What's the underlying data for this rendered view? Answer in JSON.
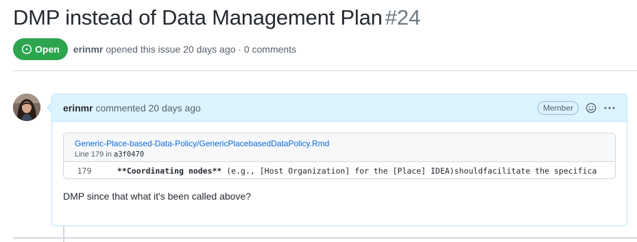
{
  "issue": {
    "title": "DMP instead of Data Management Plan",
    "number": "#24",
    "state": "Open",
    "author": "erinmr",
    "opened_text": "opened this issue 20 days ago · 0 comments"
  },
  "comment": {
    "author": "erinmr",
    "time_text": "commented 20 days ago",
    "role_badge": "Member",
    "code_ref": {
      "file_path": "Generic-Place-based-Data-Policy/GenericPlacebasedDataPolicy.Rmd",
      "line_label": "Line 179 in",
      "commit": "a3f0470",
      "line_number": "179",
      "code_bold": "**Coordinating nodes**",
      "code_rest": " (e.g., [Host Organization] for the [Place] IDEA)shouldfacilitate the specifica"
    },
    "body": "DMP since that what it's been called above?"
  },
  "colors": {
    "open_green": "#2da44e",
    "link_blue": "#0969da",
    "header_bg": "#ddf4ff",
    "header_border": "#b6e3ff"
  },
  "icons": [
    "issue-opened-icon",
    "smiley-icon",
    "kebab-horizontal-icon"
  ]
}
